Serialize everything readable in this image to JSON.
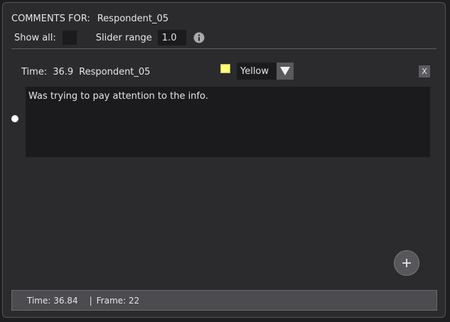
{
  "header": {
    "label": "COMMENTS FOR:",
    "respondent": "Respondent_05"
  },
  "options": {
    "show_all_label": "Show all:",
    "show_all_checked": false,
    "slider_range_label": "Slider range",
    "slider_range_value": "1.0",
    "info_icon": "info-icon"
  },
  "comment": {
    "time_label": "Time:",
    "time_value": "36.9",
    "respondent": "Respondent_05",
    "color_hex": "#ffff7a",
    "color_name": "Yellow",
    "delete_label": "X",
    "text": "Was trying to pay attention to the info."
  },
  "add_button_icon": "plus-icon",
  "status": {
    "time": "Time: 36.84",
    "separator": "|",
    "frame": "Frame: 22"
  }
}
